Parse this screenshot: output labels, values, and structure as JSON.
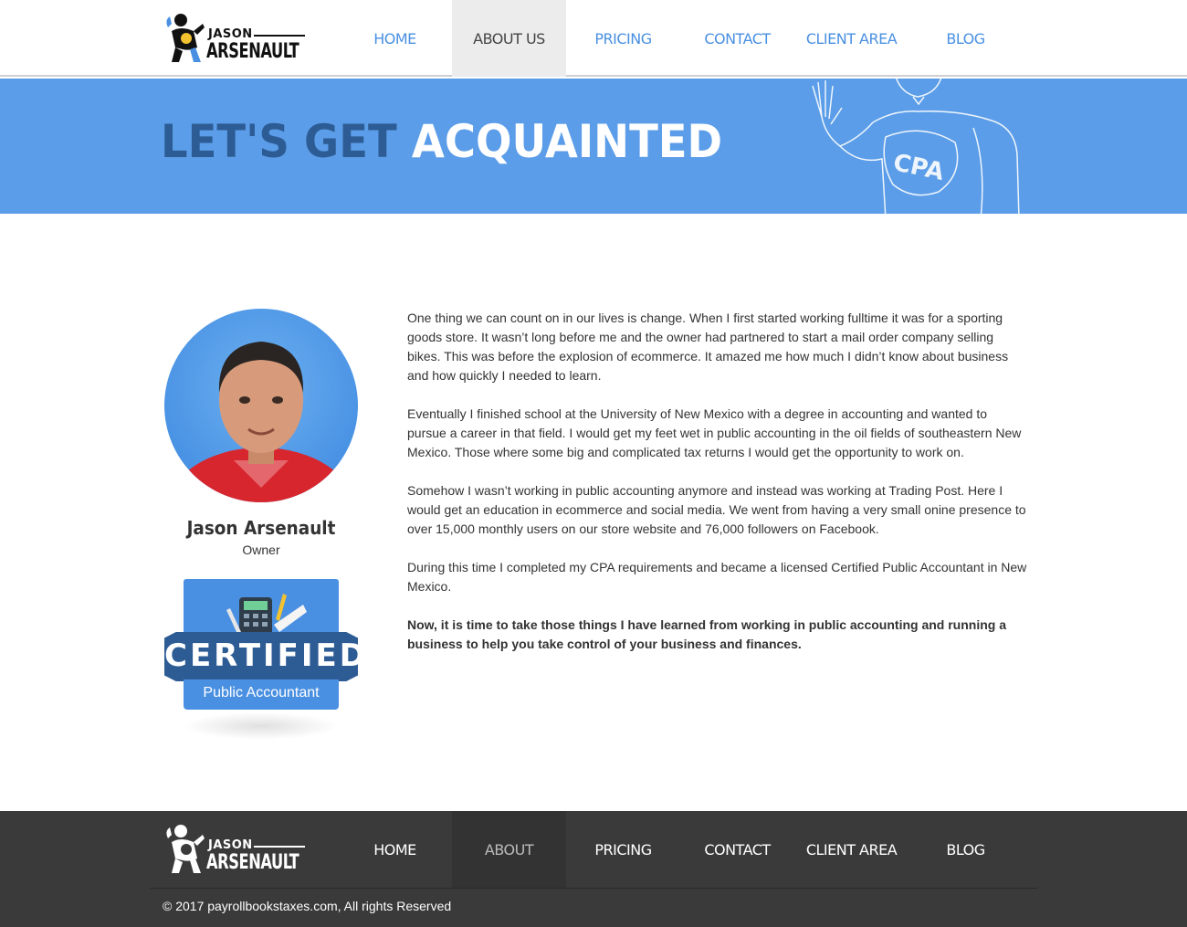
{
  "brand": {
    "logo_small": "JASON",
    "logo_big": "ARSENAULT"
  },
  "nav": {
    "items": [
      "HOME",
      "ABOUT US",
      "PRICING",
      "CONTACT",
      "CLIENT AREA",
      "BLOG"
    ],
    "active_index": 1
  },
  "banner": {
    "title_dark": "LET'S GET",
    "title_light": "ACQUAINTED",
    "art_text": "CPA"
  },
  "profile": {
    "name": "Jason Arsenault",
    "role": "Owner"
  },
  "badge": {
    "title": "CERTIFIED",
    "subtitle": "Public Accountant"
  },
  "bio": {
    "paragraphs": [
      "One thing we can count on in our lives is change. When I first started working fulltime it was for a sporting goods store. It wasn’t long before me and the owner had partnered to start a mail order company selling bikes. This was before the explosion of ecommerce. It amazed me how much I didn’t know about business and how quickly I needed to learn.",
      "Eventually I finished school at the University of New Mexico with a degree in accounting and wanted to pursue a career in that field. I would get my feet wet in public accounting in the oil fields of southeastern New Mexico. Those where some big and complicated tax returns I would get the opportunity to work on.",
      "Somehow I wasn’t working in public accounting anymore and instead was working at Trading Post. Here I would get an education in ecommerce and social media. We went from having a very small onine presence to over 15,000 monthly users on our store website and 76,000 followers on Facebook.",
      "During this time I completed my CPA requirements and became a licensed Certified Public Accountant in New Mexico."
    ],
    "closing": "Now, it is time to take those things I have learned from working in public accounting and running a business to help you take control of your business and finances."
  },
  "footer": {
    "nav_items": [
      "HOME",
      "ABOUT",
      "PRICING",
      "CONTACT",
      "CLIENT AREA",
      "BLOG"
    ],
    "active_index": 1,
    "copyright": "© 2017 payrollbookstaxes.com, All rights Reserved"
  },
  "colors": {
    "accent": "#4a90e2",
    "banner": "#5b9de8",
    "dark_blue": "#2d5c95",
    "footer": "#3a3a3a"
  }
}
